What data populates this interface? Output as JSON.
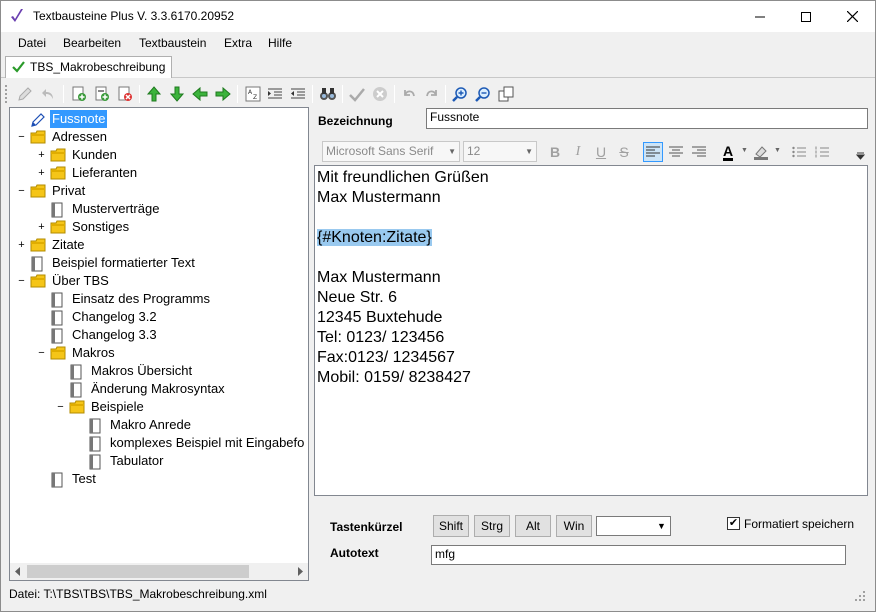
{
  "window": {
    "title": "Textbausteine Plus V. 3.3.6170.20952",
    "minimize_icon": "minimize-icon",
    "maximize_icon": "maximize-icon",
    "close_icon": "close-icon"
  },
  "menu": [
    "Datei",
    "Bearbeiten",
    "Textbaustein",
    "Extra",
    "Hilfe"
  ],
  "doc_tab": {
    "label": "TBS_Makrobeschreibung",
    "icon": "checkmark-icon"
  },
  "tree": {
    "nodes": [
      {
        "label": "Fussnote",
        "icon": "pencil-icon",
        "selected": true
      },
      {
        "label": "Adressen",
        "icon": "folder-icon",
        "expander": "−"
      },
      {
        "label": "Kunden",
        "icon": "folder-icon",
        "expander": "+"
      },
      {
        "label": "Lieferanten",
        "icon": "folder-icon",
        "expander": "+"
      },
      {
        "label": "Privat",
        "icon": "folder-icon",
        "expander": "−"
      },
      {
        "label": "Musterverträge",
        "icon": "book-icon"
      },
      {
        "label": "Sonstiges",
        "icon": "folder-icon",
        "expander": "+"
      },
      {
        "label": "Zitate",
        "icon": "folder-icon",
        "expander": "+"
      },
      {
        "label": "Beispiel formatierter Text",
        "icon": "book-icon"
      },
      {
        "label": "Über TBS",
        "icon": "folder-icon",
        "expander": "−"
      },
      {
        "label": "Einsatz des Programms",
        "icon": "book-icon"
      },
      {
        "label": "Changelog 3.2",
        "icon": "book-icon"
      },
      {
        "label": "Changelog 3.3",
        "icon": "book-icon"
      },
      {
        "label": "Makros",
        "icon": "folder-icon",
        "expander": "−"
      },
      {
        "label": "Makros Übersicht",
        "icon": "book-icon"
      },
      {
        "label": "Änderung Makrosyntax",
        "icon": "book-icon"
      },
      {
        "label": "Beispiele",
        "icon": "folder-icon",
        "expander": "−"
      },
      {
        "label": "Makro Anrede",
        "icon": "book-icon"
      },
      {
        "label": "komplexes Beispiel mit Eingabefo",
        "icon": "book-icon"
      },
      {
        "label": "Tabulator",
        "icon": "book-icon"
      },
      {
        "label": "Test",
        "icon": "book-icon"
      }
    ]
  },
  "form": {
    "bezeichnung_label": "Bezeichnung",
    "bezeichnung_value": "Fussnote",
    "font_name": "Microsoft Sans Serif",
    "font_size": "12",
    "bold": "B",
    "italic": "I",
    "underline": "U",
    "strike": "S",
    "font_color_letter": "A"
  },
  "editor": {
    "lines": [
      "Mit freundlichen Grüßen",
      "Max Mustermann",
      "",
      "{#Knoten:Zitate}",
      "",
      "Max Mustermann",
      "Neue Str. 6",
      "12345 Buxtehude",
      "Tel: 0123/ 123456",
      "Fax:0123/ 1234567",
      "Mobil: 0159/ 8238427"
    ],
    "highlight_line": "{#Knoten:Zitate}"
  },
  "shortcut": {
    "label": "Tastenkürzel",
    "buttons": [
      "Shift",
      "Strg",
      "Alt",
      "Win"
    ],
    "key_value": "",
    "formatted_label": "Formatiert speichern",
    "formatted_checked": true,
    "check_mark": "✔"
  },
  "autotext": {
    "label": "Autotext",
    "value": "mfg"
  },
  "status": {
    "file": "Datei: T:\\TBS\\TBS\\TBS_Makrobeschreibung.xml"
  }
}
